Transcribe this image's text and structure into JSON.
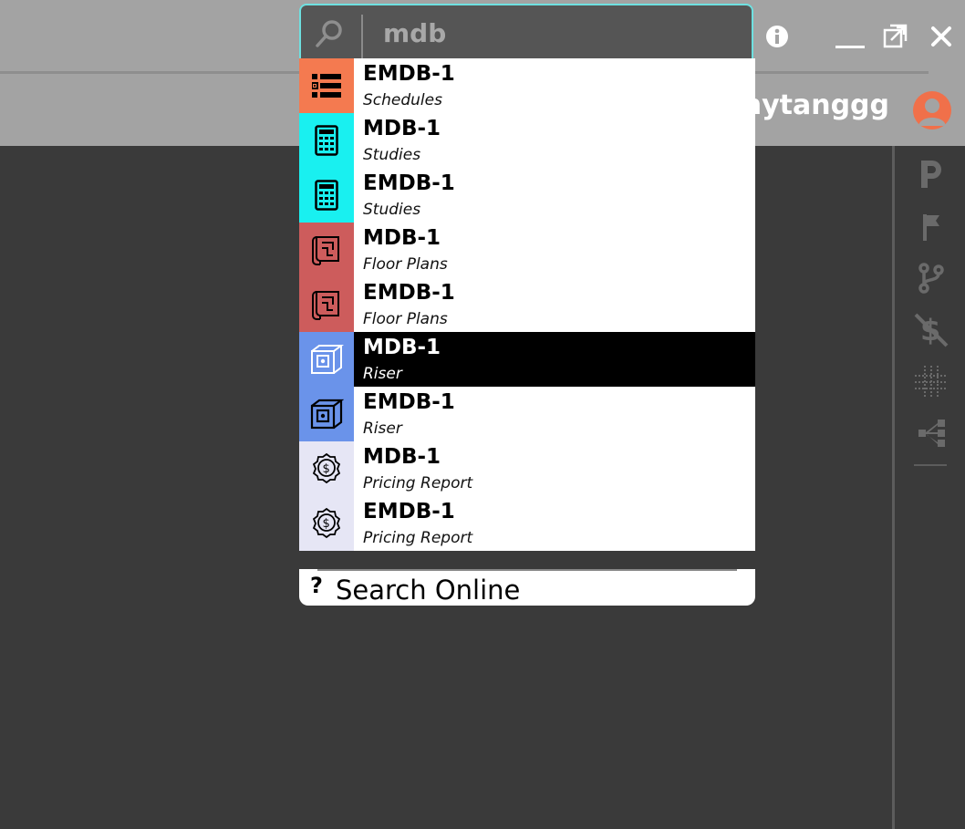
{
  "search": {
    "value": "mdb",
    "placeholder": ""
  },
  "header": {
    "username": "nytanggg"
  },
  "window_controls": [
    "info-icon",
    "minimize-icon",
    "restore-icon",
    "close-icon"
  ],
  "results": [
    {
      "title": "EMDB-1",
      "subtitle": "Schedules",
      "icon": "list-icon",
      "color": "#f47a50"
    },
    {
      "title": "MDB-1",
      "subtitle": "Studies",
      "icon": "calculator-icon",
      "color": "#19f0f0"
    },
    {
      "title": "EMDB-1",
      "subtitle": "Studies",
      "icon": "calculator-icon",
      "color": "#19f0f0"
    },
    {
      "title": "MDB-1",
      "subtitle": "Floor Plans",
      "icon": "floor-plan-icon",
      "color": "#cd5c5c"
    },
    {
      "title": "EMDB-1",
      "subtitle": "Floor Plans",
      "icon": "floor-plan-icon",
      "color": "#cd5c5c"
    },
    {
      "title": "MDB-1",
      "subtitle": "Riser",
      "icon": "riser-cube-icon",
      "color": "#6a93ea",
      "selected": true
    },
    {
      "title": "EMDB-1",
      "subtitle": "Riser",
      "icon": "riser-cube-icon",
      "color": "#6a93ea"
    },
    {
      "title": "MDB-1",
      "subtitle": "Pricing Report",
      "icon": "pricing-badge-icon",
      "color": "#e6e6f5"
    },
    {
      "title": "EMDB-1",
      "subtitle": "Pricing Report",
      "icon": "pricing-badge-icon",
      "color": "#e6e6f5"
    }
  ],
  "footer": {
    "glyph": "?",
    "label": "Search Online"
  },
  "rail_icons": [
    "p-icon",
    "flag-icon",
    "branch-icon",
    "no-dollar-icon",
    "grid-icon",
    "hierarchy-icon"
  ],
  "colors": {
    "search_border": "#6ee0e0",
    "selected_bg": "#000000",
    "avatar": "#f0704a",
    "background": "#3a3a3a"
  }
}
